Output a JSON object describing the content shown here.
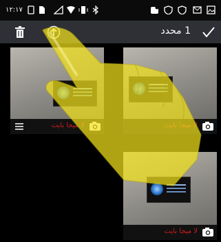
{
  "status_bar": {
    "time": "١٢:١٧",
    "icons": [
      "sim-icon",
      "file-icon",
      "signal-icon",
      "wifi-icon",
      "vibrate-icon",
      "bluetooth-icon",
      "notification-icon",
      "shield-icon",
      "shield-icon",
      "mail-icon",
      "gallery-icon"
    ]
  },
  "action_bar": {
    "selected_count": "1 محدد",
    "delete_icon": "trash-icon",
    "upload_icon": "upload-icon",
    "confirm_icon": "checkmark-icon"
  },
  "tiles": [
    {
      "caption": "لا ميجا بايت",
      "selected": false,
      "show_menu": true
    },
    {
      "caption": "لا ميجا بايت",
      "selected": true,
      "show_menu": false
    },
    {
      "caption": "لا ميجا بايت",
      "selected": false,
      "show_menu": false
    }
  ],
  "colors": {
    "accent": "#3fa9d6",
    "caption": "#d01e1e",
    "action_bar": "#2e3036",
    "hand": "#f2e21c"
  }
}
